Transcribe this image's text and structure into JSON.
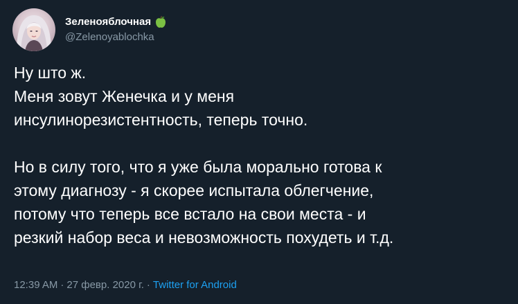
{
  "tweet": {
    "display_name": "Зеленояблочная",
    "name_emoji": "green-apple-icon",
    "handle": "@Zelenoyablochka",
    "text": "Ну што ж.\nМеня зовут Женечка и у меня\nинсулинорезистентность, теперь точно.\n\nНо в силу того, что я уже была морально готова к\nэтому диагнозу - я скорее испытала облегчение,\nпотому что теперь все встало на свои места - и\nрезкий набор веса и невозможность похудеть и т.д.",
    "time": "12:39 AM",
    "separator": "·",
    "date": "27 февр. 2020 г.",
    "source": "Twitter for Android"
  },
  "colors": {
    "background": "#15202b",
    "text": "#ffffff",
    "secondary": "#8899a6",
    "link": "#1da1f2"
  }
}
